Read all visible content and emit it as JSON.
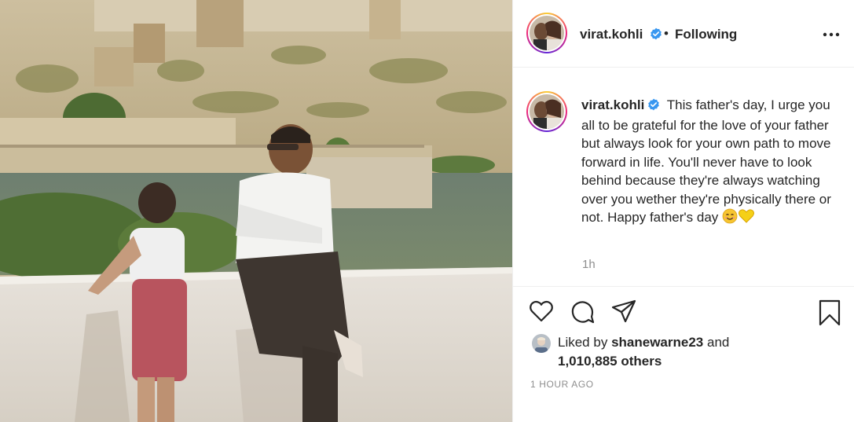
{
  "post": {
    "photo": {
      "alt": "Old photograph of a man seated on a wall beside a young boy, lake and fort in background"
    },
    "header": {
      "username": "virat.kohli",
      "separator": "•",
      "follow_status": "Following",
      "more_icon": "more-horizontal-icon",
      "verified_icon": "verified-badge-icon"
    },
    "caption": {
      "username": "virat.kohli",
      "text": "This father's day, I urge you all to be grateful for the love of your father but always look for your own path to move forward in life. You'll never have to look behind because they're always watching over you wether they're physically there or not. Happy father's day",
      "emojis": [
        "smiling-face-emoji",
        "yellow-heart-emoji"
      ],
      "time": "1h"
    },
    "actions": {
      "like_icon": "heart-icon",
      "comment_icon": "comment-icon",
      "share_icon": "paper-plane-icon",
      "save_icon": "bookmark-icon"
    },
    "likes": {
      "prefix": "Liked by",
      "user": "shanewarne23",
      "connector": "and",
      "count": "1,010,885 others"
    },
    "timestamp": "1 hour ago"
  },
  "colors": {
    "text": "#262626",
    "muted": "#8e8e8e",
    "verified": "#3897f0",
    "border": "#efefef"
  }
}
